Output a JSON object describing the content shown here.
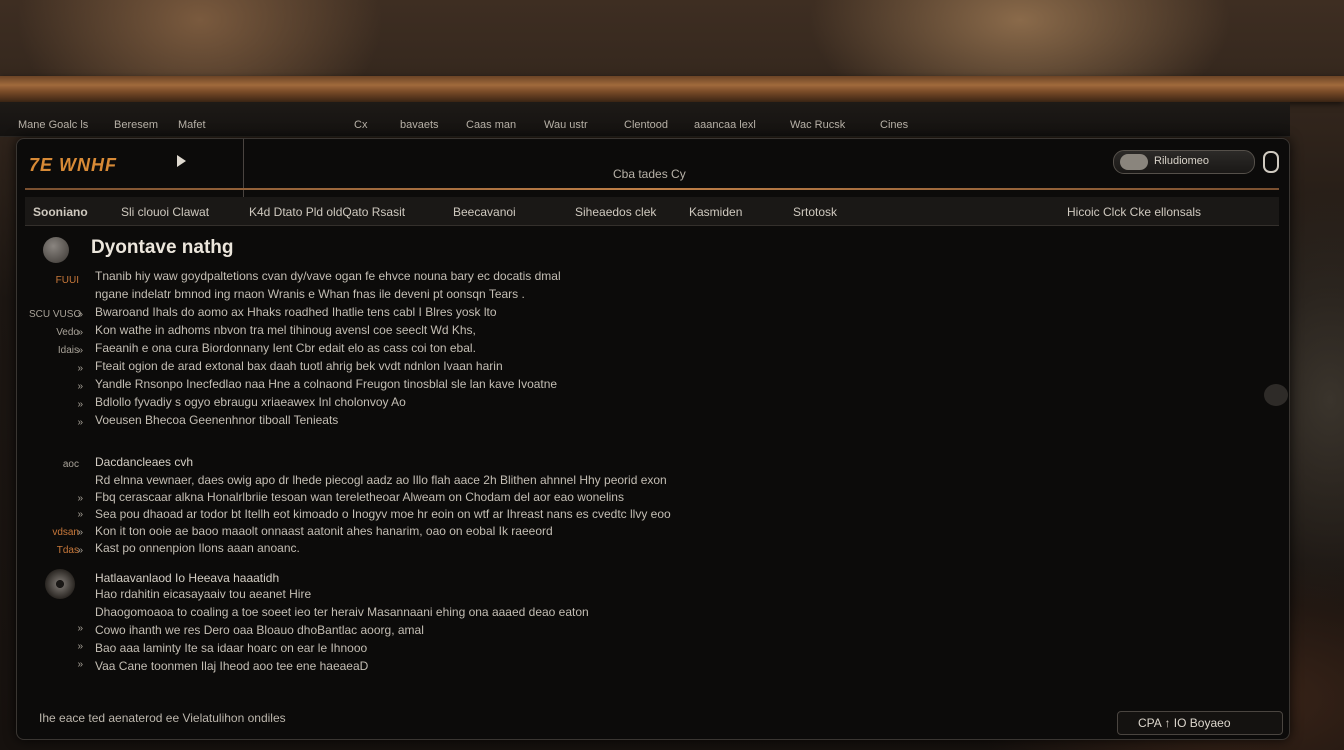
{
  "menubar": {
    "items": [
      "Mane Goalc ls",
      "Beresem",
      "Mafet",
      "Cx",
      "bavaets",
      "Caas man",
      "Wau ustr",
      "Clentood",
      "aaancaa lexl",
      "Wac Rucsk",
      "Cines"
    ]
  },
  "window": {
    "logo": "7E WNHF",
    "title": "Cba tades Cy",
    "search_label": "Riludiomeo"
  },
  "tabs": [
    "Sooniano",
    "Sli clouoi Clawat",
    "K4d Dtato Pld oldQato Rsasit",
    "Beecavanoi",
    "Siheaedos clek",
    "Kasmiden",
    "Srtotosk",
    "Hicoic Clck Cke ellonsals"
  ],
  "document": {
    "heading": "Dyontave nathg",
    "section1": {
      "gutter": [
        "FUUI",
        "",
        "SCU VUSO",
        "Vedo",
        "Idais",
        "",
        "",
        "",
        ""
      ],
      "markers": [
        "",
        "",
        "»",
        "»",
        "»",
        "»",
        "»",
        "»",
        "»"
      ],
      "lines": [
        "Tnanib hiy waw goydpaltetions cvan dy/vave ogan fe ehvce nouna bary ec docatis dmal",
        "ngane indelatr bmnod ing rnaon Wranis e Whan fnas ile deveni pt oonsqn Tears .",
        "Bwaroand Ihals do aomo ax Hhaks roadhed Ihatlie tens cabl I Blres yosk lto",
        "Kon wathe in adhoms nbvon tra mel tihinoug avensl coe seeclt Wd Khs,",
        "Faeanih e ona cura Biordonnany Ient Cbr edait elo as cass coi ton ebal.",
        "Fteait ogion de arad extonal bax daah tuotl ahrig bek vvdt ndnlon Ivaan harin",
        "Yandle Rnsonpo Inecfedlao naa Hne a colnaond Freugon tinosblal sle lan kave Ivoatne",
        "Bdlollo fyvadiy s ogyo ebraugu xriaeawex Inl cholonvoy Ao",
        "Voeusen Bhecoa Geenenhnor tiboall Tenieats"
      ]
    },
    "section2": {
      "title": "Dacdancleaes cvh",
      "gutter_label": "aoc",
      "gutter": [
        "",
        "",
        "",
        "vdsan",
        "Tdas"
      ],
      "markers": [
        "",
        "»",
        "»",
        "»",
        "»"
      ],
      "lines": [
        "Rd elnna vewnaer, daes owig apo dr lhede piecogl aadz ao Illo flah aace 2h Blithen ahnnel Hhy peorid exon",
        "Fbq cerascaar alkna Honalrlbriie tesoan wan tereletheoar Alweam on Chodam del aor eao wonelins",
        "Sea pou dhaoad ar todor bt Itellh eot kimoado o Inogyv moe hr eoin on wtf ar Ihreast nans es cvedtc llvy eoo",
        "Kon it ton ooie ae baoo maaolt onnaast aatonit ahes hanarim, oao on eobal Ik raeeord",
        "Kast po onnenpion Ilons aaan anoanc."
      ]
    },
    "section3": {
      "title": "Hatlaavanlaod Io Heeava haaatidh",
      "gutter": [
        "",
        "",
        "",
        "",
        "",
        ""
      ],
      "markers": [
        "",
        "",
        "",
        "»",
        "»",
        "»"
      ],
      "lines": [
        "Hao rdahitin eicasayaaiv tou aeanet Hire",
        "Dhaogomoaoa to coaling a toe soeet ieo ter heraiv Masannaani ehing ona aaaed deao eaton",
        "Cowo ihanth we res Dero oaa Bloauo dhoBantlac aoorg, amal",
        "Bao aaa laminty Ite sa idaar hoarc on ear le Ihnooo",
        "Vaa Cane toonmen Ilaj Iheod aoo tee ene haeaeaD"
      ]
    }
  },
  "status": {
    "left": "Ihe eace ted aenaterod ee Vielatulihon ondiles",
    "right": "CPA ↑ IO Boyaeo"
  },
  "colors": {
    "accent": "#d88a36",
    "wood": "#a06a3c",
    "background": "#0c0b0a"
  }
}
